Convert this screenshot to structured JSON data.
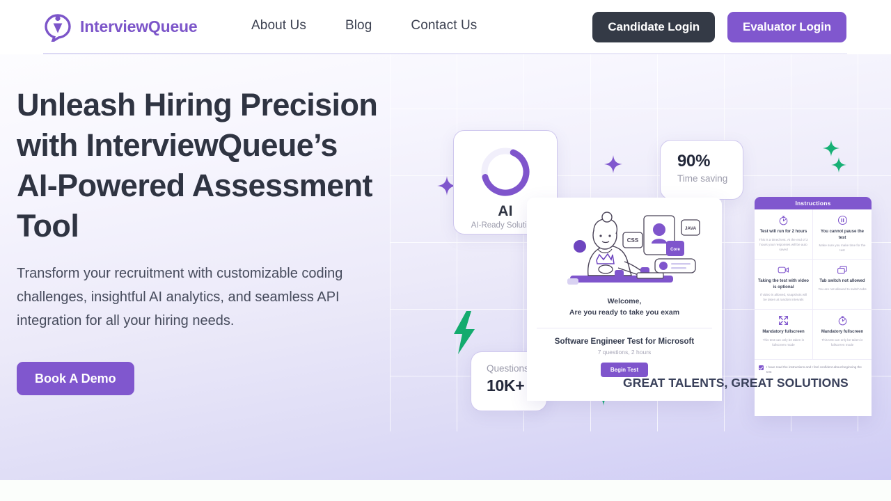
{
  "brand": {
    "name": "InterviewQueue",
    "logo_icon": "interview-queue-logo-icon",
    "color": "#7c55c9"
  },
  "nav": {
    "links": [
      {
        "label": "About Us",
        "name": "nav-link-about-us"
      },
      {
        "label": "Blog",
        "name": "nav-link-blog"
      },
      {
        "label": "Contact Us",
        "name": "nav-link-contact-us"
      }
    ],
    "candidate_login_label": "Candidate Login",
    "evaluator_login_label": "Evaluator Login",
    "candidate_login_color": "#343a46",
    "evaluator_login_color": "#8057ce"
  },
  "hero": {
    "headline": "Unleash Hiring Precision with InterviewQueue’s AI-Powered Assessment Tool",
    "subcopy": "Transform your recruitment with customizable coding challenges, insightful AI analytics, and seamless API integration for all your hiring needs.",
    "cta_label": "Book A Demo",
    "cta_color": "#8057ce"
  },
  "visual": {
    "ai_card": {
      "ring_percent": 65,
      "ring_color": "#7f55cc",
      "ring_track_color": "#f0eefa",
      "title": "AI",
      "subtitle": "AI-Ready Solutions"
    },
    "pct_card": {
      "value": "90%",
      "label": "Time saving"
    },
    "questions_card": {
      "label": "Questions",
      "value": "10K+"
    },
    "exam_panel": {
      "welcome_line1": "Welcome,",
      "welcome_line2": "Are you ready to take you exam",
      "test_title": "Software Engineer Test for Microsoft",
      "test_meta": "7 questions, 2 hours",
      "begin_button_label": "Begin Test",
      "skill_tags": [
        "CSS",
        "JAVA",
        "Core"
      ]
    },
    "instructions": {
      "header": "Instructions",
      "tiles": [
        {
          "icon": "stopwatch-icon",
          "title": "Test will run for\n2 hours",
          "desc": "This is a timed test. At the end of 2 hours your responses will be auto saved"
        },
        {
          "icon": "pause-icon",
          "title": "You cannot pause\nthe test",
          "desc": "Make sure you make time for the test"
        },
        {
          "icon": "video-camera-icon",
          "title": "Taking the test with\nvideo is optional",
          "desc": "If video is allowed, snapshots will be taken at random intervals"
        },
        {
          "icon": "tab-switch-icon",
          "title": "Tab switch not\nallowed",
          "desc": "You are not allowed to switch tabs"
        },
        {
          "icon": "fullscreen-icon",
          "title": "Mandatory\nfullscreen",
          "desc": "This test can only be taken in fullscreen mode"
        },
        {
          "icon": "stopwatch-icon",
          "title": "Mandatory\nfullscreen",
          "desc": "This test can only be taken in fullscreen mode"
        }
      ],
      "consent": "I have read the instructions and I feel confident about beginning the test"
    },
    "tagline": "GREAT TALENTS, GREAT SOLUTIONS",
    "sparkles": [
      {
        "name": "sparkle-purple-left",
        "color": "#8057ce"
      },
      {
        "name": "sparkle-purple-mid",
        "color": "#8057ce"
      },
      {
        "name": "sparkle-green-top",
        "color": "#17b075"
      },
      {
        "name": "sparkle-green-top-2",
        "color": "#17b075"
      },
      {
        "name": "sparkle-green-bottom",
        "color": "#17b075"
      },
      {
        "name": "lightning-bolt",
        "color": "#13ab6e"
      }
    ]
  }
}
